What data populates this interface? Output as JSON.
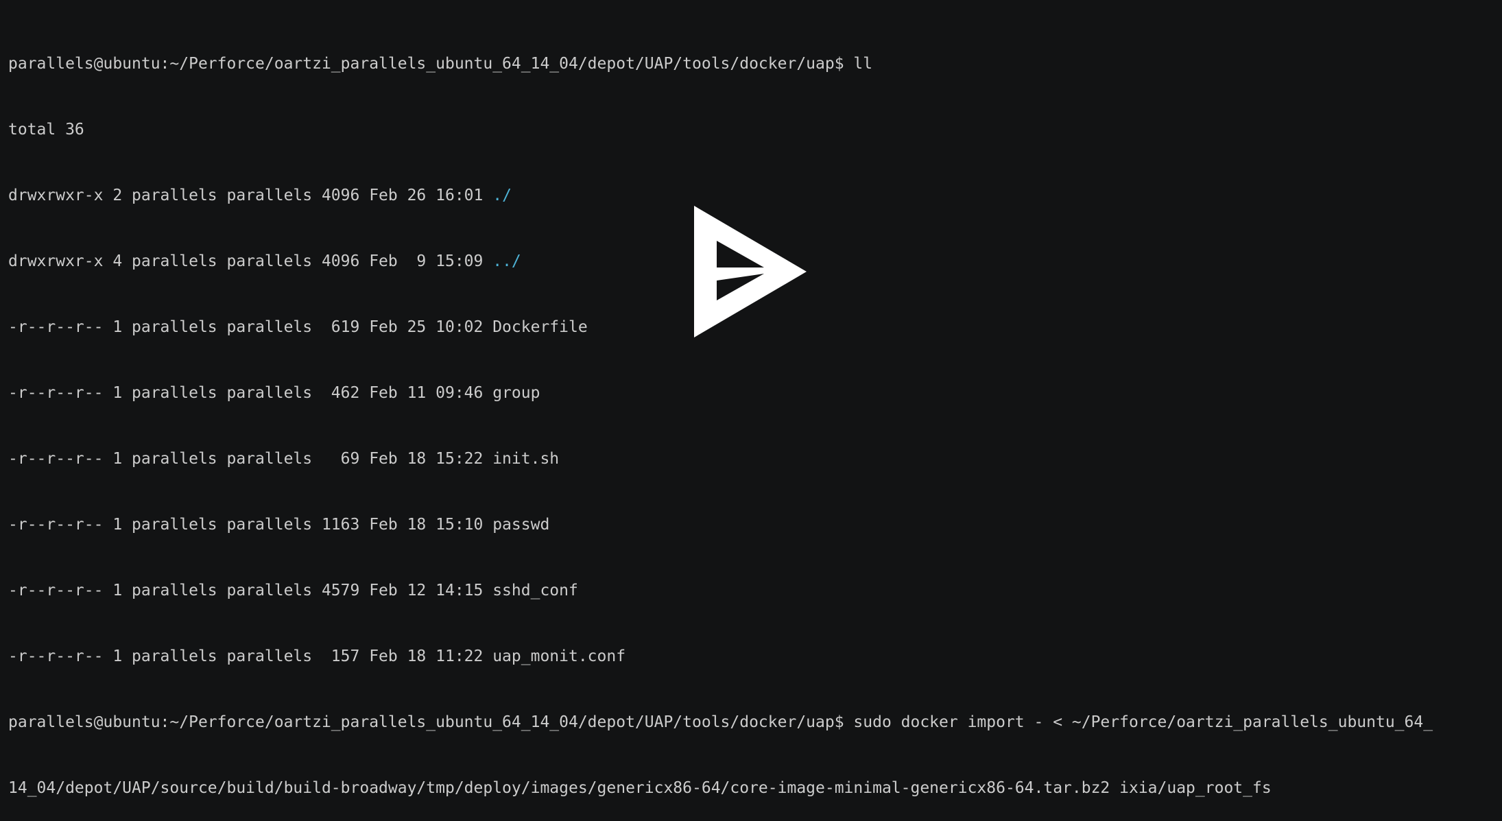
{
  "terminal": {
    "lines": [
      {
        "text": "parallels@ubuntu:~/Perforce/oartzi_parallels_ubuntu_64_14_04/depot/UAP/tools/docker/uap$ ll"
      },
      {
        "text": "total 36"
      },
      {
        "text": "drwxrwxr-x 2 parallels parallels 4096 Feb 26 16:01 ",
        "name": "./"
      },
      {
        "text": "drwxrwxr-x 4 parallels parallels 4096 Feb  9 15:09 ",
        "name": "../"
      },
      {
        "text": "-r--r--r-- 1 parallels parallels  619 Feb 25 10:02 Dockerfile"
      },
      {
        "text": "-r--r--r-- 1 parallels parallels  462 Feb 11 09:46 group"
      },
      {
        "text": "-r--r--r-- 1 parallels parallels   69 Feb 18 15:22 init.sh"
      },
      {
        "text": "-r--r--r-- 1 parallels parallels 1163 Feb 18 15:10 passwd"
      },
      {
        "text": "-r--r--r-- 1 parallels parallels 4579 Feb 12 14:15 sshd_conf"
      },
      {
        "text": "-r--r--r-- 1 parallels parallels  157 Feb 18 11:22 uap_monit.conf"
      },
      {
        "text": "parallels@ubuntu:~/Perforce/oartzi_parallels_ubuntu_64_14_04/depot/UAP/tools/docker/uap$ sudo docker import - < ~/Perforce/oartzi_parallels_ubuntu_64_"
      },
      {
        "text": "14_04/depot/UAP/source/build/build-broadway/tmp/deploy/images/genericx86-64/core-image-minimal-genericx86-64.tar.bz2 ixia/uap_root_fs"
      }
    ]
  },
  "overlay": {
    "icon": "asciinema-play-icon",
    "color": "#ffffff"
  },
  "colors": {
    "background": "#121314",
    "foreground": "#cccccc",
    "directory": "#4eb3d6"
  }
}
